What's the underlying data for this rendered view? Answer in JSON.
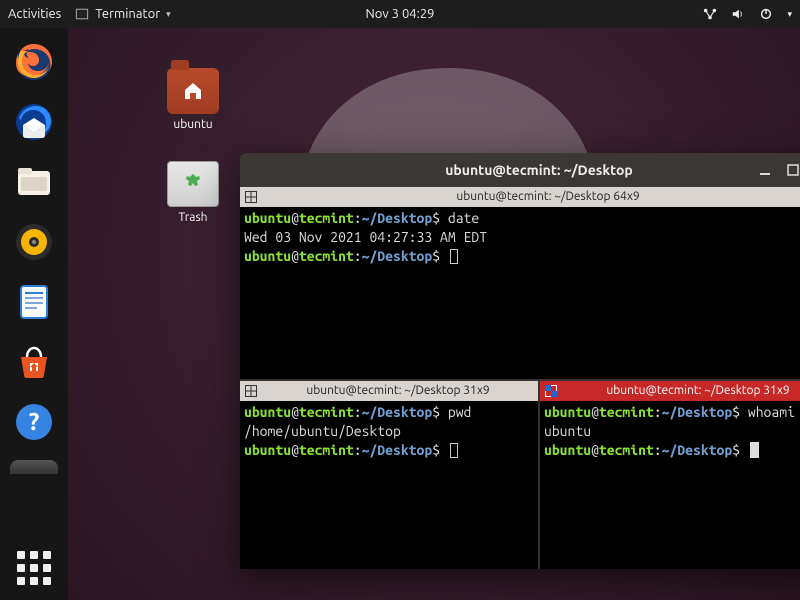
{
  "topbar": {
    "activities": "Activities",
    "app_name": "Terminator",
    "clock": "Nov 3  04:29"
  },
  "desktop": {
    "home_label": "ubuntu",
    "trash_label": "Trash"
  },
  "window": {
    "title": "ubuntu@tecmint: ~/Desktop"
  },
  "prompt": {
    "user": "ubuntu",
    "at": "@",
    "host": "tecmint",
    "colon": ":",
    "path": "~/Desktop",
    "dollar": "$"
  },
  "panes": {
    "top": {
      "tab": "ubuntu@tecmint: ~/Desktop 64x9",
      "cmd1": "date",
      "out1": "Wed 03 Nov 2021 04:27:33 AM EDT"
    },
    "bl": {
      "tab": "ubuntu@tecmint: ~/Desktop 31x9",
      "cmd": "pwd",
      "out": "/home/ubuntu/Desktop"
    },
    "br": {
      "tab": "ubuntu@tecmint: ~/Desktop 31x9",
      "cmd": "whoami",
      "out": "ubuntu"
    }
  }
}
